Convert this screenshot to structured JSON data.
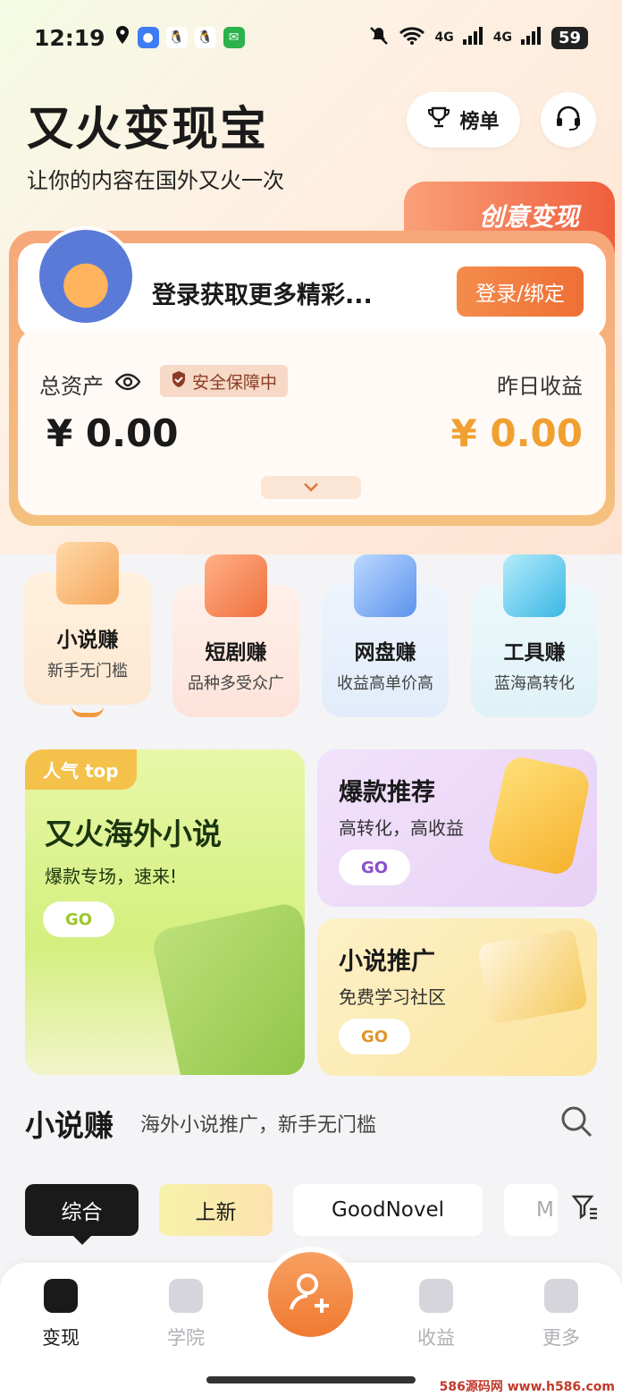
{
  "status_bar": {
    "time": "12:19",
    "net1": "6",
    "net2": "4G",
    "net3": "4G",
    "battery": "59"
  },
  "header": {
    "title": "又火变现宝",
    "subtitle": "让你的内容在国外又火一次",
    "rank_label": "榜单",
    "creative_tag": "创意变现"
  },
  "account": {
    "login_prompt": "登录获取更多精彩...",
    "login_button": "登录/绑定",
    "total_assets_label": "总资产",
    "safe_badge": "安全保障中",
    "total_assets_value": "¥ 0.00",
    "yesterday_label": "昨日收益",
    "yesterday_value": "¥ 0.00"
  },
  "categories": [
    {
      "name": "小说赚",
      "desc": "新手无门槛",
      "color": "#fde6cf"
    },
    {
      "name": "短剧赚",
      "desc": "品种多受众广",
      "color": "#fde2d8"
    },
    {
      "name": "网盘赚",
      "desc": "收益高单价高",
      "color": "#e3edfb"
    },
    {
      "name": "工具赚",
      "desc": "蓝海高转化",
      "color": "#e0f3f8"
    }
  ],
  "promos": {
    "big": {
      "tag": "人气 top",
      "title": "又火海外小说",
      "subtitle": "爆款专场，速来!",
      "go": "GO"
    },
    "pink": {
      "title": "爆款推荐",
      "subtitle": "高转化，高收益",
      "go": "GO"
    },
    "yellow": {
      "title": "小说推广",
      "subtitle": "免费学习社区",
      "go": "GO"
    }
  },
  "section": {
    "title": "小说赚",
    "subtitle": "海外小说推广，新手无门槛"
  },
  "chips": [
    "综合",
    "上新",
    "GoodNovel",
    "M"
  ],
  "tabs": [
    "变现",
    "学院",
    "收益",
    "更多"
  ],
  "watermark": "586源码网 www.h586.com"
}
